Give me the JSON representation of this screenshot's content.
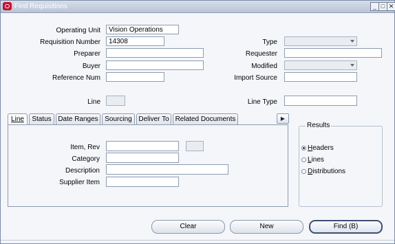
{
  "window": {
    "title": "Find Requisitions",
    "controls": [
      "_",
      "□",
      "✕"
    ]
  },
  "form": {
    "operating_unit": {
      "label": "Operating Unit",
      "value": "Vision Operations"
    },
    "requisition_number": {
      "label": "Requisition Number",
      "value": "14308"
    },
    "type": {
      "label": "Type",
      "value": ""
    },
    "preparer": {
      "label": "Preparer",
      "value": ""
    },
    "requester": {
      "label": "Requester",
      "value": ""
    },
    "buyer": {
      "label": "Buyer",
      "value": ""
    },
    "modified": {
      "label": "Modified",
      "value": ""
    },
    "reference_num": {
      "label": "Reference Num",
      "value": ""
    },
    "import_source": {
      "label": "Import Source",
      "value": ""
    },
    "line": {
      "label": "Line",
      "value": ""
    },
    "line_type": {
      "label": "Line Type",
      "value": ""
    }
  },
  "tabs": [
    {
      "label": "Line",
      "active": true
    },
    {
      "label": "Status"
    },
    {
      "label": "Date Ranges"
    },
    {
      "label": "Sourcing"
    },
    {
      "label": "Deliver To"
    },
    {
      "label": "Related Documents"
    }
  ],
  "tab_nav": "▶",
  "line_tab": {
    "item_rev": {
      "label": "Item, Rev",
      "value": "",
      "rev_value": ""
    },
    "category": {
      "label": "Category",
      "value": ""
    },
    "description": {
      "label": "Description",
      "value": ""
    },
    "supplier_item": {
      "label": "Supplier Item",
      "value": ""
    }
  },
  "results": {
    "title": "Results",
    "options": [
      {
        "label": "Headers",
        "selected": true
      },
      {
        "label": "Lines",
        "selected": false
      },
      {
        "label": "Distributions",
        "selected": false
      }
    ]
  },
  "buttons": {
    "clear": "Clear",
    "new": "New",
    "find": "Find (B)"
  }
}
